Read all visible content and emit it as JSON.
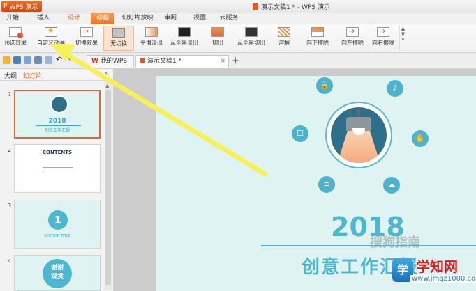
{
  "app": {
    "button_label": "WPS 演示",
    "window_title": "演示文稿1 * - WPS 演示"
  },
  "menu": {
    "tabs": [
      "开始",
      "插入",
      "设计",
      "动画",
      "幻灯片放映",
      "审阅",
      "视图",
      "云服务"
    ],
    "active_tab": "动画"
  },
  "ribbon": {
    "buttons": [
      {
        "label": "预选效果",
        "icon": "preview-icon"
      },
      {
        "label": "自定义动画",
        "icon": "custom-animation-icon"
      },
      {
        "label": "切换效果",
        "icon": "switch-effect-icon"
      },
      {
        "label": "无切换",
        "icon": "no-transition-icon"
      },
      {
        "label": "平滑淡出",
        "icon": "fade-smooth-icon"
      },
      {
        "label": "从全黑淡出",
        "icon": "fade-black-icon"
      },
      {
        "label": "切出",
        "icon": "cut-icon"
      },
      {
        "label": "从全黑切出",
        "icon": "cut-black-icon"
      },
      {
        "label": "溶解",
        "icon": "dissolve-icon"
      },
      {
        "label": "向下擦除",
        "icon": "wipe-down-icon"
      },
      {
        "label": "向左擦除",
        "icon": "wipe-left-icon"
      },
      {
        "label": "向右擦除",
        "icon": "wipe-right-icon"
      }
    ]
  },
  "doc_tabs": [
    {
      "label": "我的WPS",
      "mark": "W"
    },
    {
      "label": "演示文稿1 *"
    }
  ],
  "left_pane": {
    "tabs": [
      "大纲",
      "幻灯片"
    ],
    "active_tab": "幻灯片",
    "close": "×"
  },
  "thumbnails": [
    {
      "number": "1",
      "year": "2018",
      "subtitle": "创意工作汇报"
    },
    {
      "number": "2",
      "heading": "CONTENTS"
    },
    {
      "number": "3",
      "big": "1",
      "caption": "SECTION TITLE"
    },
    {
      "number": "4",
      "text": "谢谢\n观赏"
    }
  ],
  "slide": {
    "year": "2018",
    "subtitle": "创意工作汇报",
    "icons": [
      "lock-icon",
      "speaker-icon",
      "chat-icon",
      "handshake-icon",
      "sliders-icon",
      "cloud-upload-icon"
    ]
  },
  "watermark": {
    "text": "搜狗指南",
    "site_name": "学知网",
    "site_url": "www.jmqz1000.com"
  },
  "colors": {
    "accent": "#e57729",
    "slide_bg": "#dff3f3",
    "slide_teal": "#4fb6cf",
    "arrow": "#f6f05a"
  }
}
